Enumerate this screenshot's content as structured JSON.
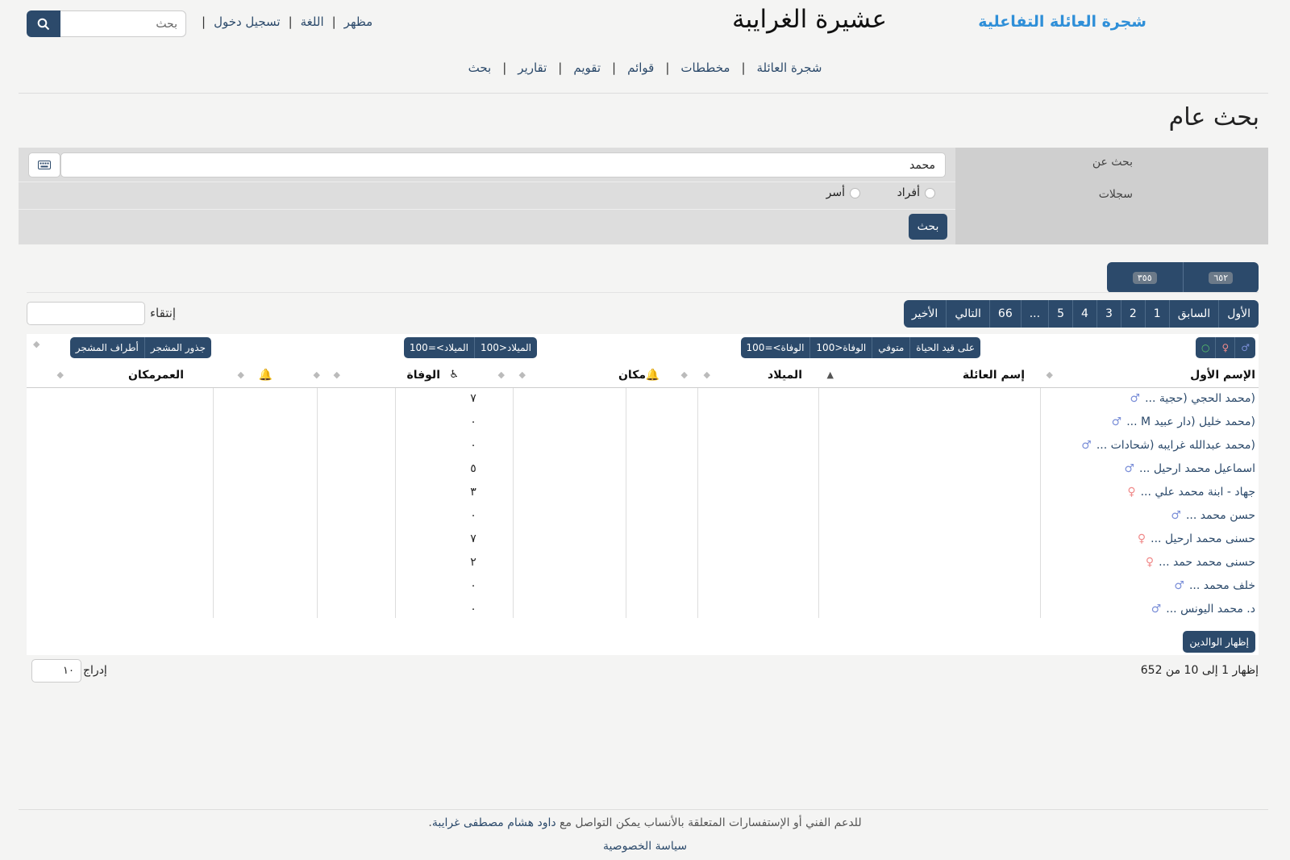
{
  "header": {
    "brand": "شجرة العائلة التفاعلية",
    "title": "عشيرة الغرايبة",
    "links": [
      "مظهر",
      "اللغة",
      "تسجيل دخول"
    ],
    "search_placeholder": "بحث"
  },
  "nav": [
    "شجرة العائلة",
    "مخططات",
    "قوائم",
    "تقويم",
    "تقارير",
    "بحث"
  ],
  "page_heading": "بحث عام",
  "form": {
    "search_for_label": "بحث عن",
    "query_value": "محمد",
    "records_label": "سجلات",
    "radio_individuals": "أفراد",
    "radio_families": "أسر",
    "submit_label": "بحث"
  },
  "counts": {
    "individuals": "٦٥٢",
    "families": "٣٥٥"
  },
  "pager": [
    "الأول",
    "السابق",
    "1",
    "2",
    "3",
    "4",
    "5",
    "...",
    "66",
    "التالي",
    "الأخير"
  ],
  "filter_label": "إنتقاء",
  "filters": {
    "sex": [
      "♂",
      "♀",
      "○"
    ],
    "alive": [
      "على قيد الحياة",
      "متوفي",
      "الوفاة<100",
      "الوفاة>=100"
    ],
    "birth": [
      "الميلاد<100",
      "الميلاد>=100"
    ],
    "tree": [
      "جذور المشجر",
      "أطراف المشجر"
    ]
  },
  "table": {
    "headers": {
      "given_name": "الإسم الأول",
      "surname": "إسم العائلة",
      "birth": "الميلاد",
      "place": "مكان",
      "death": "الوفاة",
      "age": "العمر",
      "death_place": "مكان"
    },
    "rows": [
      {
        "name": "(محمد الحجي (حجية ...",
        "sex": "m",
        "count": "٧"
      },
      {
        "name": "(محمد خليل (دار عبيد M ...",
        "sex": "m",
        "count": "٠"
      },
      {
        "name": "(محمد عبدالله غرايبه (شحادات ...",
        "sex": "m",
        "count": "٠"
      },
      {
        "name": "اسماعيل محمد ارحيل ...",
        "sex": "m",
        "count": "٥"
      },
      {
        "name": "جهاد - ابنة محمد علي ...",
        "sex": "f",
        "count": "٣"
      },
      {
        "name": "حسن محمد ...",
        "sex": "m",
        "count": "٠"
      },
      {
        "name": "حسنى محمد ارحيل ...",
        "sex": "f",
        "count": "٧"
      },
      {
        "name": "حسنى محمد حمد ...",
        "sex": "f",
        "count": "٢"
      },
      {
        "name": "خلف محمد ...",
        "sex": "m",
        "count": "٠"
      },
      {
        "name": "د. محمد اليونس ...",
        "sex": "m",
        "count": "٠"
      }
    ],
    "show_parents_label": "إظهار الوالدين"
  },
  "showing_info": "إظهار 1 إلى 10 من 652",
  "length_label": "إدراج",
  "length_value": "١٠",
  "footer": {
    "support_text": "للدعم الفني أو الإستفسارات المتعلقة بالأنساب يمكن التواصل مع",
    "contact_name": "داود هشام مصطفى غرايبة",
    "privacy": "سياسة الخصوصية"
  },
  "colors": {
    "primary": "#2c4a6b",
    "brand": "#2f8fd8",
    "male": "#7b8fd8",
    "female": "#f08a8a"
  }
}
